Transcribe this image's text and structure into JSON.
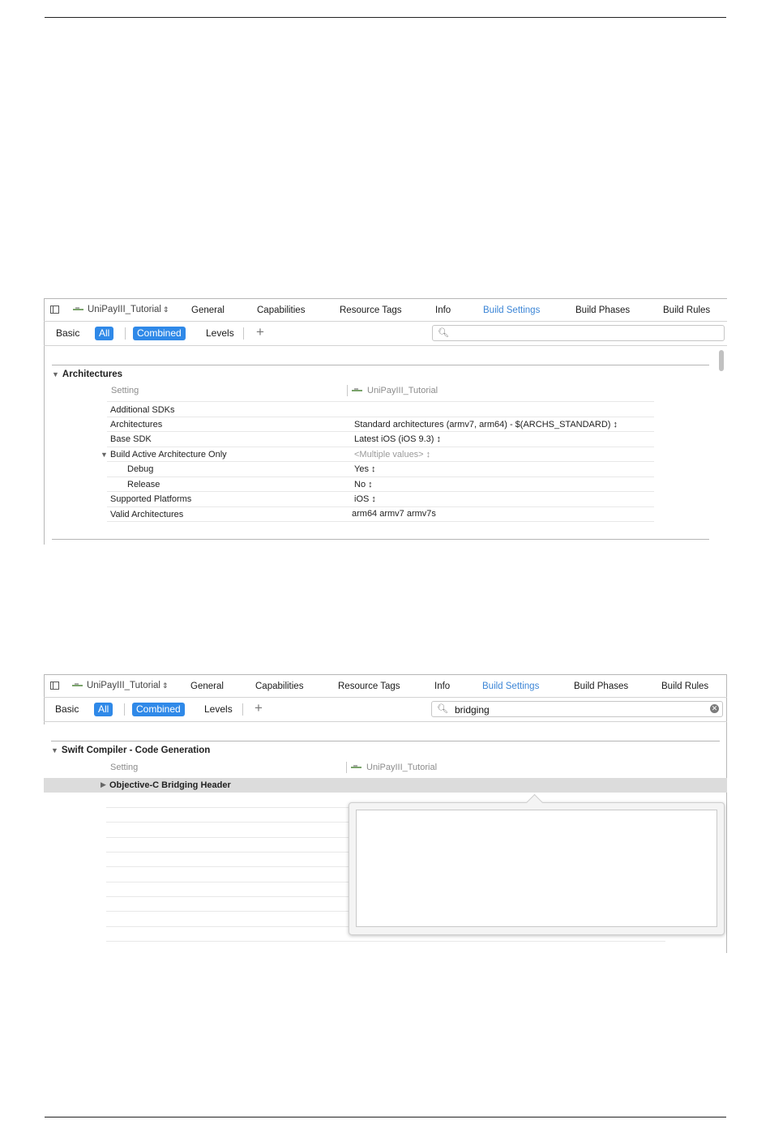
{
  "tabs": {
    "target": "UniPayIII_Tutorial",
    "general": "General",
    "capabilities": "Capabilities",
    "resource_tags": "Resource Tags",
    "info": "Info",
    "build_settings": "Build Settings",
    "build_phases": "Build Phases",
    "build_rules": "Build Rules"
  },
  "filters": {
    "basic": "Basic",
    "all": "All",
    "combined": "Combined",
    "levels": "Levels",
    "add": "+"
  },
  "panel1": {
    "search_value": "",
    "section_title": "Architectures",
    "setting_header": "Setting",
    "target_header": "UniPayIII_Tutorial",
    "rows": [
      {
        "label": "Additional SDKs",
        "value": ""
      },
      {
        "label": "Architectures",
        "value": "Standard architectures (armv7, arm64)  -  $(ARCHS_STANDARD) ↕"
      },
      {
        "label": "Base SDK",
        "value": "Latest iOS (iOS 9.3) ↕"
      },
      {
        "label": "Build Active Architecture Only",
        "value": "<Multiple values> ↕"
      },
      {
        "label": "Debug",
        "value": "Yes ↕"
      },
      {
        "label": "Release",
        "value": "No ↕"
      },
      {
        "label": "Supported Platforms",
        "value": "iOS ↕"
      },
      {
        "label": "Valid Architectures",
        "value": "arm64 armv7 armv7s"
      }
    ]
  },
  "panel2": {
    "search_value": "bridging",
    "section_title": "Swift Compiler - Code Generation",
    "setting_header": "Setting",
    "target_header": "UniPayIII_Tutorial",
    "selected_row": "Objective-C Bridging Header"
  },
  "colors": {
    "accent": "#2f89e8",
    "active_tab": "#3b85d6"
  },
  "icons": [
    "sidebar-toggle-icon",
    "target-icon",
    "search-icon",
    "clear-icon",
    "disclosure-triangle-icon"
  ]
}
